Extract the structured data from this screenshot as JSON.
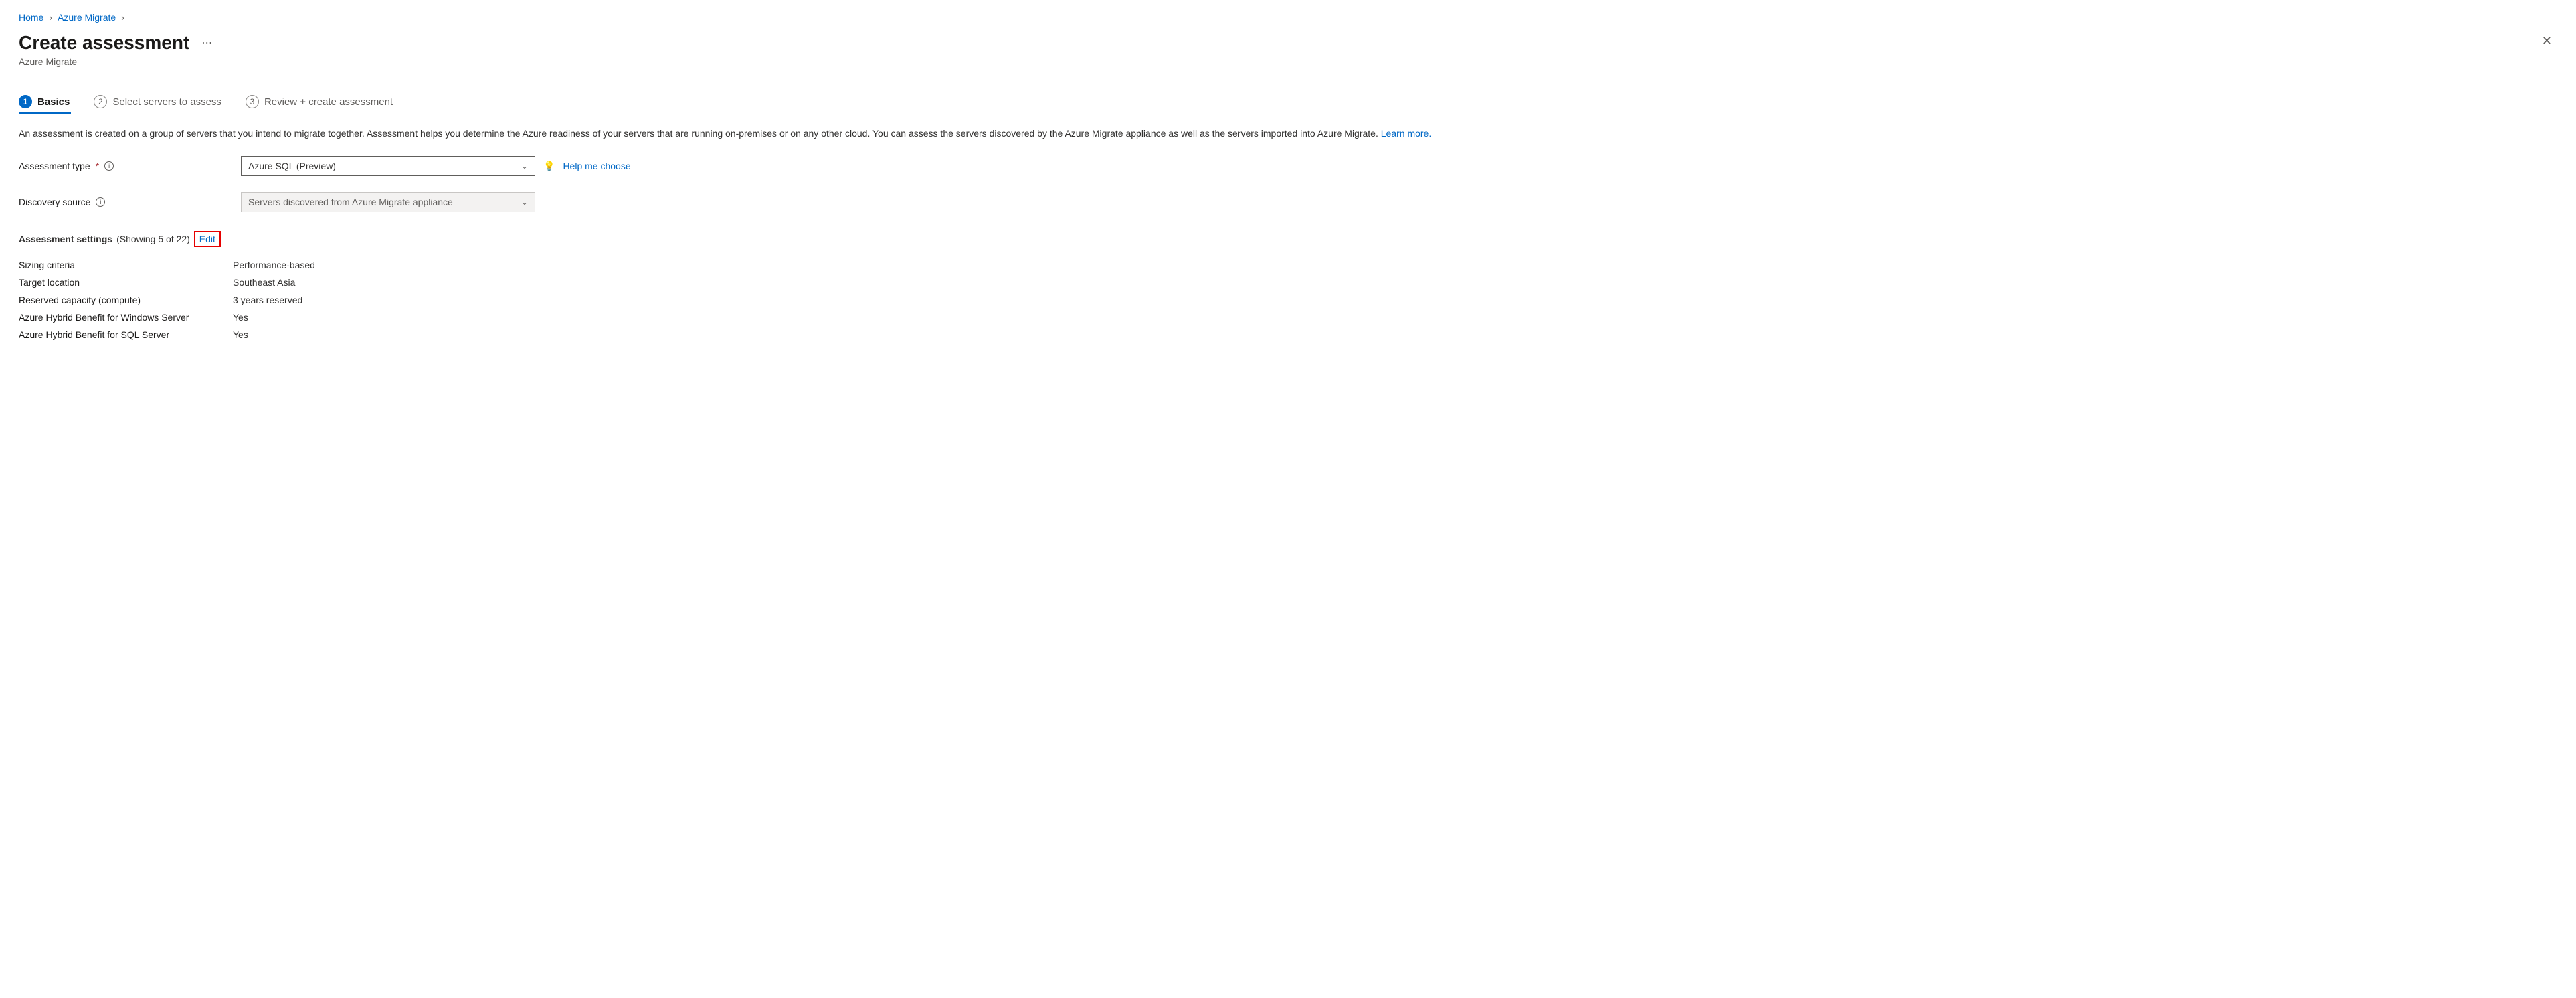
{
  "breadcrumb": {
    "items": [
      {
        "label": "Home"
      },
      {
        "label": "Azure Migrate"
      }
    ]
  },
  "header": {
    "title": "Create assessment",
    "subtitle": "Azure Migrate"
  },
  "stepper": {
    "steps": [
      {
        "num": "1",
        "label": "Basics"
      },
      {
        "num": "2",
        "label": "Select servers to assess"
      },
      {
        "num": "3",
        "label": "Review + create assessment"
      }
    ]
  },
  "description": {
    "text": "An assessment is created on a group of servers that you intend to migrate together. Assessment helps you determine the Azure readiness of your servers that are running on-premises or on any other cloud. You can assess the servers discovered by the Azure Migrate appliance as well as the servers imported into Azure Migrate. ",
    "learn_more": "Learn more."
  },
  "form": {
    "assessment_type": {
      "label": "Assessment type",
      "value": "Azure SQL (Preview)",
      "help": "Help me choose"
    },
    "discovery_source": {
      "label": "Discovery source",
      "value": "Servers discovered from Azure Migrate appliance"
    }
  },
  "settings": {
    "heading": "Assessment settings",
    "showing": "(Showing 5 of 22)",
    "edit": "Edit",
    "rows": [
      {
        "key": "Sizing criteria",
        "value": "Performance-based"
      },
      {
        "key": "Target location",
        "value": "Southeast Asia"
      },
      {
        "key": "Reserved capacity (compute)",
        "value": "3 years reserved"
      },
      {
        "key": "Azure Hybrid Benefit for Windows Server",
        "value": "Yes"
      },
      {
        "key": "Azure Hybrid Benefit for SQL Server",
        "value": "Yes"
      }
    ]
  }
}
